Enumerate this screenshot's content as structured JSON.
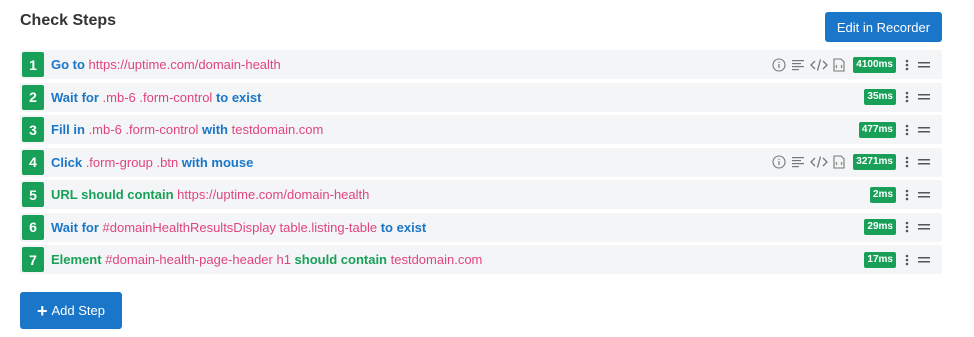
{
  "header": {
    "title": "Check Steps",
    "edit_label": "Edit in Recorder"
  },
  "steps": [
    {
      "num": "1",
      "parts": [
        {
          "t": "Go to",
          "c": "kw blue"
        },
        {
          "t": " https://uptime.com/domain-health",
          "c": "val"
        }
      ],
      "duration": "4100ms",
      "extra_icons": true
    },
    {
      "num": "2",
      "parts": [
        {
          "t": "Wait for",
          "c": "kw blue"
        },
        {
          "t": " .mb-6 .form-control",
          "c": "val"
        },
        {
          "t": " to exist",
          "c": "kw blue"
        }
      ],
      "duration": "35ms",
      "extra_icons": false
    },
    {
      "num": "3",
      "parts": [
        {
          "t": "Fill in",
          "c": "kw blue"
        },
        {
          "t": " .mb-6 .form-control",
          "c": "val"
        },
        {
          "t": " with",
          "c": "kw blue"
        },
        {
          "t": " testdomain.com",
          "c": "val"
        }
      ],
      "duration": "477ms",
      "extra_icons": false
    },
    {
      "num": "4",
      "parts": [
        {
          "t": "Click",
          "c": "kw blue"
        },
        {
          "t": " .form-group .btn",
          "c": "val"
        },
        {
          "t": " with mouse",
          "c": "kw blue"
        }
      ],
      "duration": "3271ms",
      "extra_icons": true
    },
    {
      "num": "5",
      "parts": [
        {
          "t": "URL should contain",
          "c": "kw green"
        },
        {
          "t": " https://uptime.com/domain-health",
          "c": "val"
        }
      ],
      "duration": "2ms",
      "extra_icons": false
    },
    {
      "num": "6",
      "parts": [
        {
          "t": "Wait for",
          "c": "kw blue"
        },
        {
          "t": " #domainHealthResultsDisplay table.listing-table",
          "c": "val"
        },
        {
          "t": " to exist",
          "c": "kw blue"
        }
      ],
      "duration": "29ms",
      "extra_icons": false
    },
    {
      "num": "7",
      "parts": [
        {
          "t": "Element",
          "c": "kw green"
        },
        {
          "t": " #domain-health-page-header h1",
          "c": "val"
        },
        {
          "t": " should contain",
          "c": "kw green"
        },
        {
          "t": " testdomain.com",
          "c": "val"
        }
      ],
      "duration": "17ms",
      "extra_icons": false
    }
  ],
  "footer": {
    "add_label": "Add Step"
  },
  "colors": {
    "accent": "#1a76c8",
    "success": "#18a058",
    "value": "#e0457b"
  },
  "icons": [
    "info-icon",
    "text-lines-icon",
    "code-icon",
    "file-icon",
    "kebab-menu-icon",
    "drag-handle-icon",
    "plus-icon"
  ]
}
